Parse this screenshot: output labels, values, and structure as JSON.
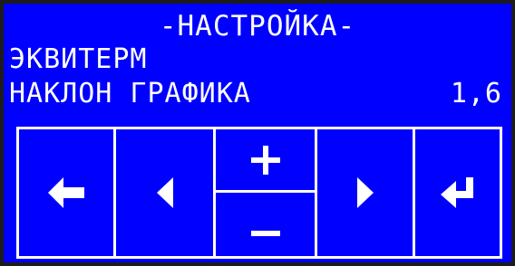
{
  "screen": {
    "title": "-НАСТРОЙКА-",
    "line1": "ЭКВИТЕРМ",
    "line2": "НАКЛОН ГРАФИКА",
    "value": "1,6"
  },
  "keys": {
    "back_icon": "arrow-left-icon",
    "prev_icon": "triangle-left-icon",
    "increase_icon": "plus-icon",
    "decrease_icon": "minus-icon",
    "next_icon": "triangle-right-icon",
    "enter_icon": "enter-icon"
  },
  "colors": {
    "background": "#0000ff",
    "foreground": "#ffffff",
    "bezel": "#1c1c1c"
  }
}
